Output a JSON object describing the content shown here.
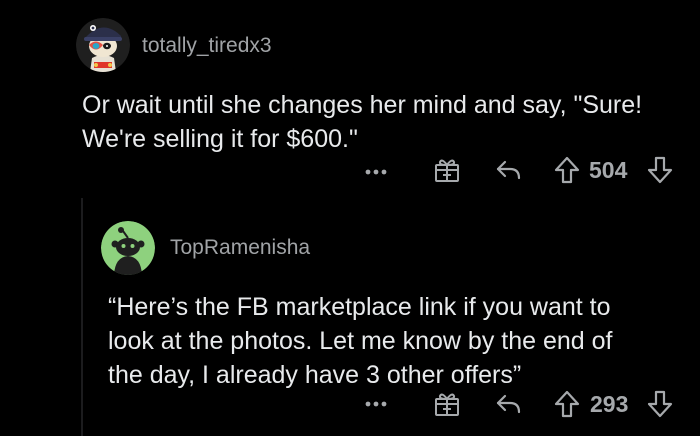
{
  "comments": [
    {
      "username": "totally_tiredx3",
      "body_lines": [
        "Or wait until she changes her mind and say, \"Sure!",
        "We're selling it for $600.\""
      ],
      "score": "504",
      "avatar_icon": "snoo-avatar-cap-icon"
    },
    {
      "username": "TopRamenisha",
      "body_lines": [
        "“Here’s the FB marketplace link if you want to",
        "look at the photos. Let me know by the end of",
        "the day, I already have 3 other offers”"
      ],
      "score": "293",
      "avatar_icon": "default-snoo-avatar-icon"
    }
  ],
  "colors": {
    "background": "#000000",
    "text": "#e8eaec",
    "muted": "#a6a9ac",
    "avatar_green": "#8ed17e",
    "avatar_dark": "#1f1f1f"
  }
}
